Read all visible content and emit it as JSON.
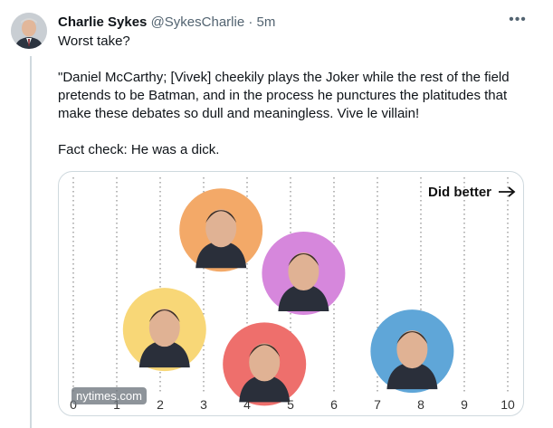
{
  "tweet": {
    "author_name": "Charlie Sykes",
    "author_handle": "@SykesCharlie",
    "separator": "·",
    "time": "5m",
    "more_glyph": "•••",
    "paragraphs": [
      "Worst take?",
      "\"Daniel McCarthy; [Vivek] cheekily plays the Joker while the rest of the field pretends to be Batman, and in the process he punctures the platitudes that make these debates so dull and meaningless. Vive le villain!",
      "Fact check: He was a dick."
    ]
  },
  "media": {
    "watermark": "nytimes.com",
    "chart_data": {
      "type": "scatter",
      "x_axis_ticks": [
        "0",
        "1",
        "2",
        "3",
        "4",
        "5",
        "6",
        "7",
        "8",
        "9",
        "10"
      ],
      "xlim": [
        0,
        10
      ],
      "grid": "vertical dotted lines at each integer",
      "annotation": "Did better",
      "annotation_arrow": "right",
      "points": [
        {
          "x": 3.4,
          "y_level": 0.16,
          "color": "#f3a968"
        },
        {
          "x": 5.3,
          "y_level": 0.36,
          "color": "#d687dc"
        },
        {
          "x": 2.1,
          "y_level": 0.62,
          "color": "#f8d777"
        },
        {
          "x": 7.8,
          "y_level": 0.72,
          "color": "#5fa6d8"
        },
        {
          "x": 4.4,
          "y_level": 0.78,
          "color": "#ee6f6c"
        }
      ]
    }
  }
}
